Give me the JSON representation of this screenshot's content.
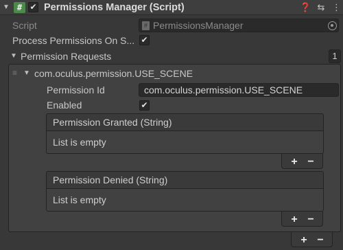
{
  "header": {
    "title": "Permissions Manager (Script)",
    "enabled": true,
    "icons": [
      "help-icon",
      "presets-icon",
      "menu-icon"
    ]
  },
  "script_field": {
    "label": "Script",
    "value": "PermissionsManager"
  },
  "process_on_start": {
    "label": "Process Permissions On S...",
    "checked": true
  },
  "permission_requests": {
    "label": "Permission Requests",
    "size": "1",
    "elements": [
      {
        "title": "com.oculus.permission.USE_SCENE",
        "permission_id_label": "Permission Id",
        "permission_id_value": "com.oculus.permission.USE_SCENE",
        "enabled_label": "Enabled",
        "enabled": true,
        "granted_list": {
          "title": "Permission Granted (String)",
          "empty_text": "List is empty"
        },
        "denied_list": {
          "title": "Permission Denied (String)",
          "empty_text": "List is empty"
        }
      }
    ]
  },
  "buttons": {
    "add": "+",
    "remove": "−"
  }
}
